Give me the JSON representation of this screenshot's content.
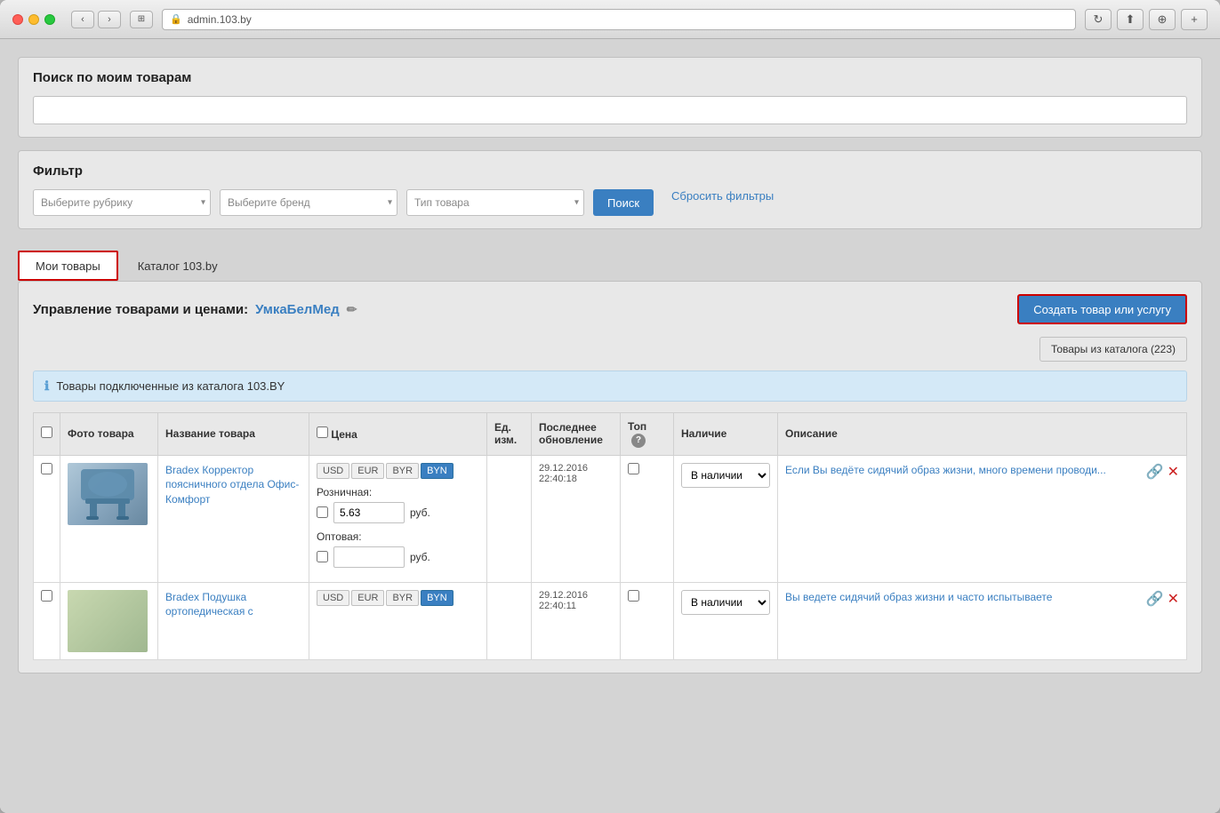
{
  "browser": {
    "url": "admin.103.by",
    "lock_icon": "🔒"
  },
  "search_section": {
    "title": "Поиск по моим товарам",
    "input_placeholder": ""
  },
  "filter_section": {
    "title": "Фильтр",
    "rubric_placeholder": "Выберите рубрику",
    "brand_placeholder": "Выберите бренд",
    "type_placeholder": "Тип товара",
    "search_btn": "Поиск",
    "reset_btn": "Сбросить фильтры"
  },
  "tabs": {
    "my_goods": "Мои товары",
    "catalog": "Каталог 103.by"
  },
  "main": {
    "title_prefix": "Управление товарами и ценами:",
    "company_name": "УмкаБелМед",
    "create_btn": "Создать товар или услугу",
    "catalog_count_btn": "Товары из каталога (223)"
  },
  "info_banner": {
    "text": "Товары подключенные из каталога 103.BY"
  },
  "table": {
    "headers": {
      "photo": "Фото товара",
      "name": "Название товара",
      "price": "Цена",
      "unit": "Ед. изм.",
      "updated": "Последнее обновление",
      "top": "Топ",
      "availability": "Наличие",
      "description": "Описание"
    },
    "products": [
      {
        "id": 1,
        "name": "Bradex Корректор поясничного отдела Офис-Комфорт",
        "currencies": [
          "USD",
          "EUR",
          "BYR",
          "BYN"
        ],
        "active_currency": "BYN",
        "retail_label": "Розничная:",
        "retail_price": "5.63",
        "retail_currency": "руб.",
        "wholesale_label": "Оптовая:",
        "wholesale_price": "",
        "wholesale_currency": "руб.",
        "unit": "",
        "updated": "29.12.2016",
        "updated_time": "22:40:18",
        "availability": "В наличии",
        "description": "Если Вы ведёте сидячий образ жизни, много времени проводи..."
      },
      {
        "id": 2,
        "name": "Bradex Подушка ортопедическая с",
        "currencies": [
          "USD",
          "EUR",
          "BYR",
          "BYN"
        ],
        "active_currency": "BYN",
        "retail_label": "",
        "retail_price": "",
        "retail_currency": "",
        "wholesale_label": "",
        "wholesale_price": "",
        "wholesale_currency": "",
        "unit": "",
        "updated": "29.12.2016",
        "updated_time": "22:40:11",
        "availability": "В наличии",
        "description": "Вы ведете сидячий образ жизни и часто испытываете"
      }
    ]
  },
  "nav": {
    "back": "‹",
    "forward": "›"
  }
}
